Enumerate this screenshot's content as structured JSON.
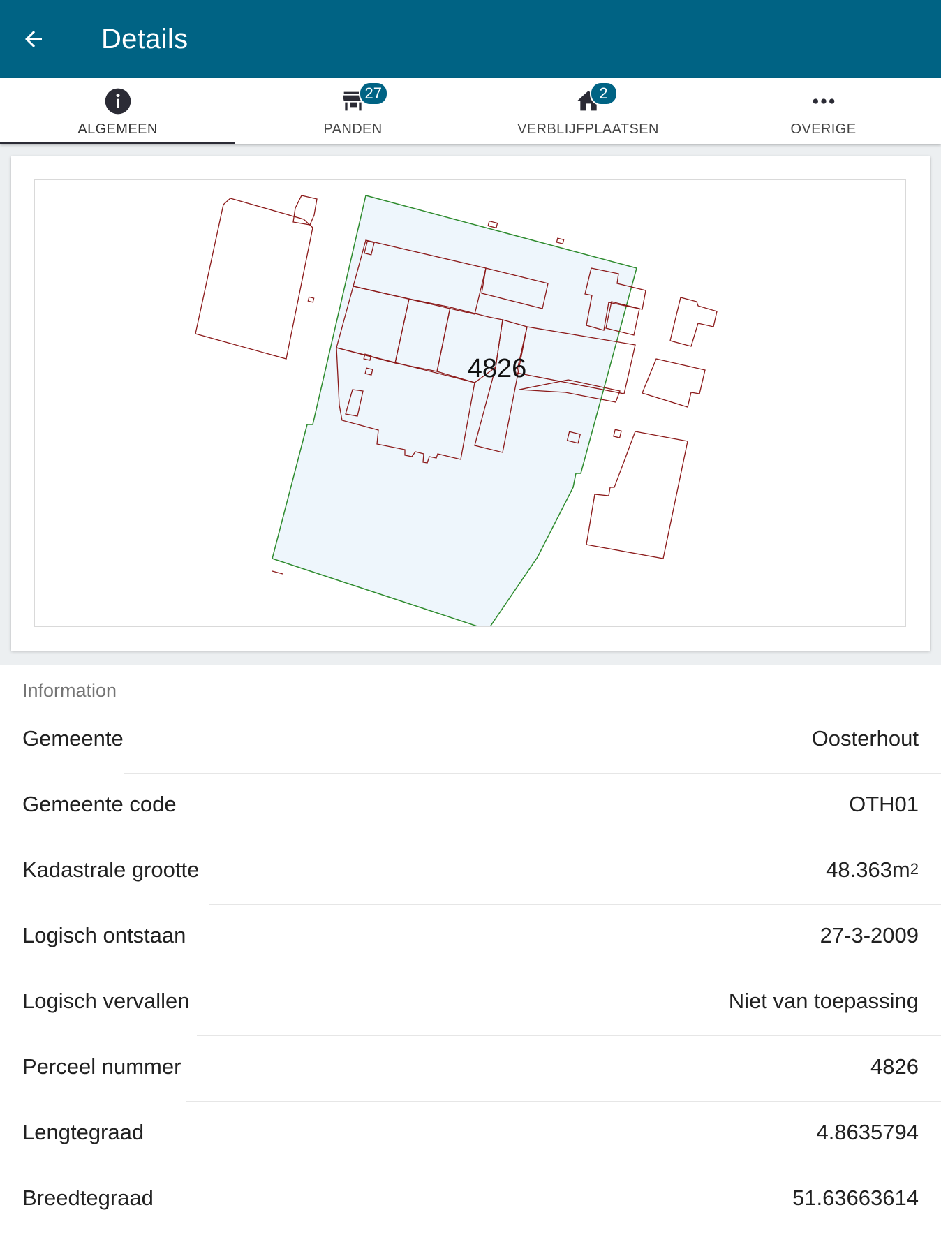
{
  "appbar": {
    "title": "Details"
  },
  "tabs": [
    {
      "label": "ALGEMEEN",
      "icon": "info-icon",
      "active": true
    },
    {
      "label": "PANDEN",
      "icon": "store-icon",
      "badge": "27"
    },
    {
      "label": "VERBLIJFPLAATSEN",
      "icon": "home-icon",
      "badge": "2"
    },
    {
      "label": "OVERIGE",
      "icon": "more-horiz-icon"
    }
  ],
  "map": {
    "parcel_label": "4826"
  },
  "info": {
    "header": "Information",
    "rows": [
      {
        "label": "Gemeente",
        "value": "Oosterhout"
      },
      {
        "label": "Gemeente code",
        "value": "OTH01"
      },
      {
        "label": "Kadastrale grootte",
        "value": "48.363m",
        "unit_sup": "2"
      },
      {
        "label": "Logisch ontstaan",
        "value": "27-3-2009"
      },
      {
        "label": "Logisch vervallen",
        "value": "Niet van toepassing"
      },
      {
        "label": "Perceel nummer",
        "value": "4826"
      },
      {
        "label": "Lengtegraad",
        "value": "4.8635794"
      },
      {
        "label": "Breedtegraad",
        "value": "51.63663614"
      }
    ]
  },
  "colors": {
    "primary": "#006384",
    "parcel_fill": "#eef6fc",
    "parcel_stroke": "#2e8b2e",
    "building_stroke": "#8b1a1a"
  }
}
